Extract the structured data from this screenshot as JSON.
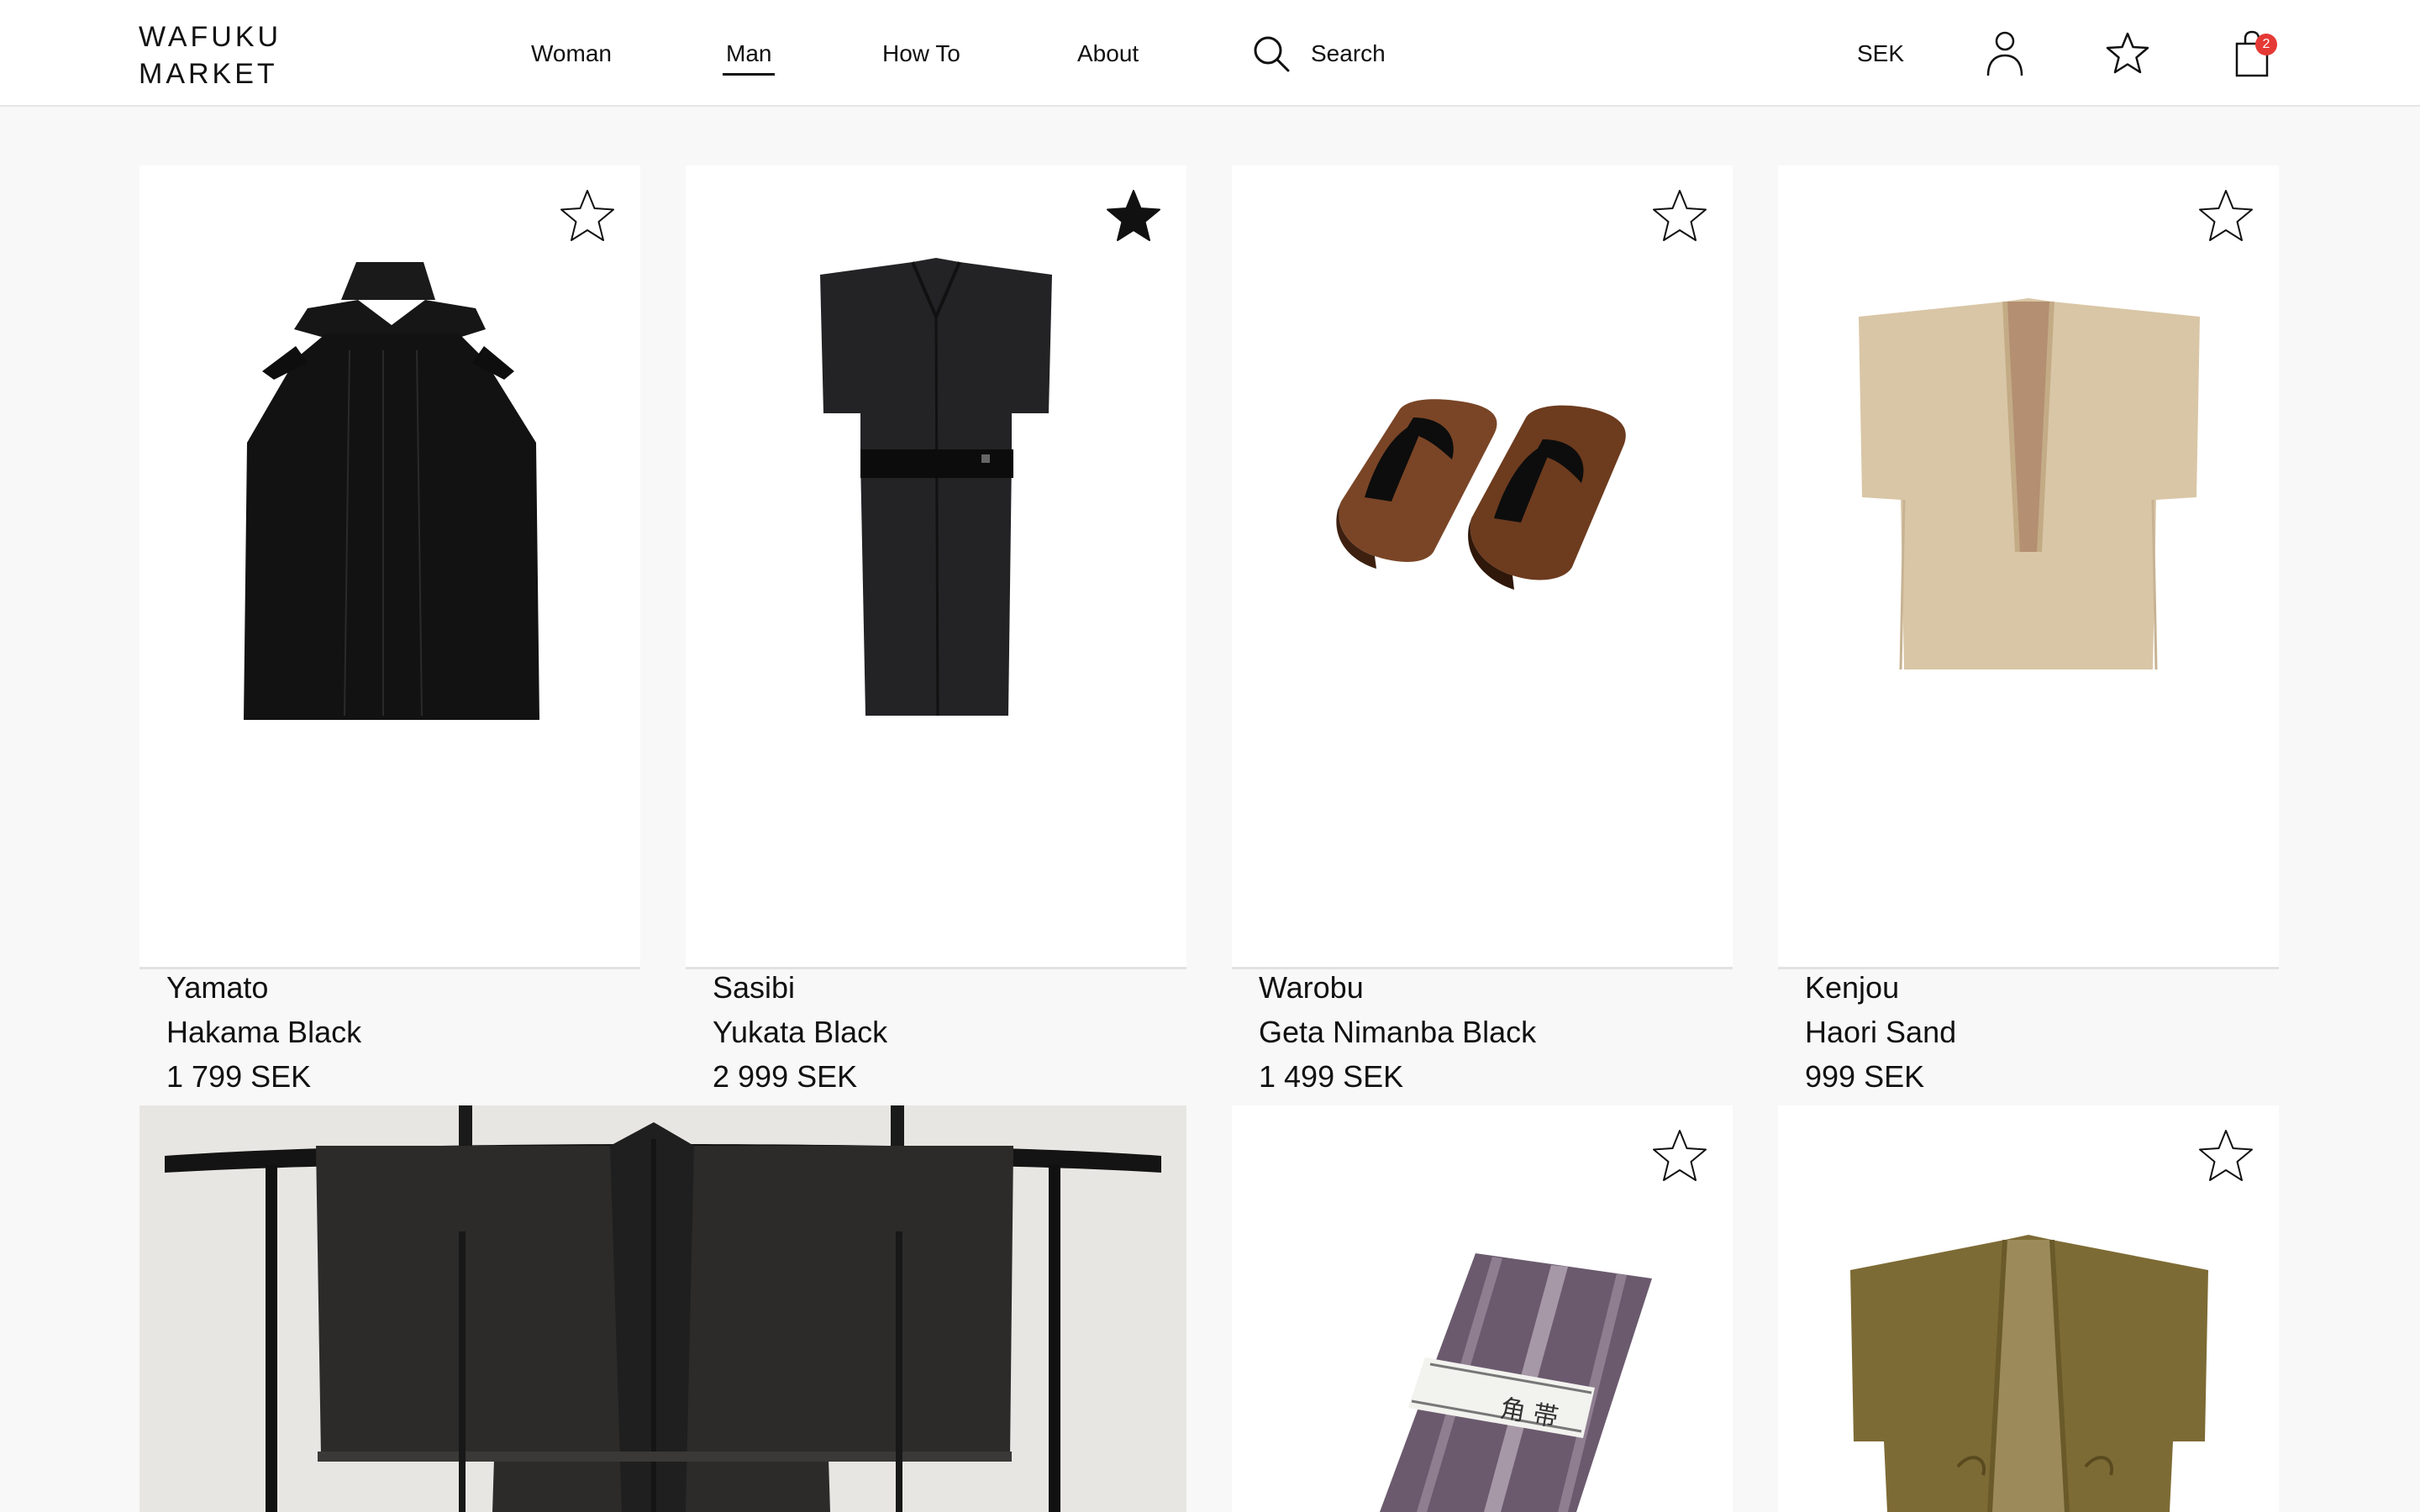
{
  "brand": {
    "line1": "WAFUKU",
    "line2": "MARKET"
  },
  "nav": {
    "items": [
      {
        "label": "Woman"
      },
      {
        "label": "Man"
      },
      {
        "label": "How To"
      },
      {
        "label": "About"
      }
    ],
    "active": "Man"
  },
  "search": {
    "label": "Search"
  },
  "header": {
    "currency": "SEK",
    "cart_count": "2"
  },
  "products": [
    {
      "brand": "Yamato",
      "name": "Hakama Black",
      "price": "1 799 SEK",
      "favorited": false
    },
    {
      "brand": "Sasibi",
      "name": "Yukata Black",
      "price": "2 999 SEK",
      "favorited": true
    },
    {
      "brand": "Warobu",
      "name": "Geta Nimanba Black",
      "price": "1 499 SEK",
      "favorited": false
    },
    {
      "brand": "Kenjou",
      "name": "Haori Sand",
      "price": "999 SEK",
      "favorited": false
    },
    {
      "favorited": false
    },
    {
      "favorited": false
    }
  ],
  "colors": {
    "badge": "#e53935",
    "background": "#f8f8f8",
    "card": "#ffffff"
  }
}
